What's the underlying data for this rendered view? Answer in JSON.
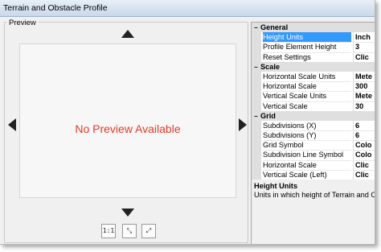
{
  "window": {
    "title": "Terrain and Obstacle Profile"
  },
  "preview": {
    "group_label": "Preview",
    "message": "No Preview Available",
    "message_color": "#e03b2a",
    "buttons": [
      {
        "icon": "one-to-one-icon",
        "label": "1:1"
      },
      {
        "icon": "collapse-icon",
        "label": "⤡"
      },
      {
        "icon": "expand-icon",
        "label": "⤢"
      }
    ]
  },
  "properties": [
    {
      "type": "category",
      "label": "General"
    },
    {
      "type": "prop",
      "name": "Height Units",
      "value": "Inch",
      "selected": true
    },
    {
      "type": "prop",
      "name": "Profile Element Height",
      "value": "3"
    },
    {
      "type": "prop",
      "name": "Reset Settings",
      "value": "Clic"
    },
    {
      "type": "category",
      "label": "Scale"
    },
    {
      "type": "prop",
      "name": "Horizontal Scale Units",
      "value": "Mete"
    },
    {
      "type": "prop",
      "name": "Horizontal Scale",
      "value": "300"
    },
    {
      "type": "prop",
      "name": "Vertical Scale Units",
      "value": "Mete"
    },
    {
      "type": "prop",
      "name": "Vertical Scale",
      "value": "30"
    },
    {
      "type": "category",
      "label": "Grid"
    },
    {
      "type": "prop",
      "name": "Subdivisions (X)",
      "value": "6"
    },
    {
      "type": "prop",
      "name": "Subdivisions (Y)",
      "value": "6"
    },
    {
      "type": "prop",
      "name": "Grid Symbol",
      "value": "Colo"
    },
    {
      "type": "prop",
      "name": "Subdivision Line Symbol",
      "value": "Colo"
    },
    {
      "type": "prop",
      "name": "Horizontal Scale",
      "value": "Clic"
    },
    {
      "type": "prop",
      "name": "Vertical Scale (Left)",
      "value": "Clic"
    },
    {
      "type": "prop",
      "name": "Vertical Scale (Right)",
      "value": "Clic"
    }
  ],
  "description": {
    "title": "Height Units",
    "text": "Units in which height of Terrain and O"
  }
}
